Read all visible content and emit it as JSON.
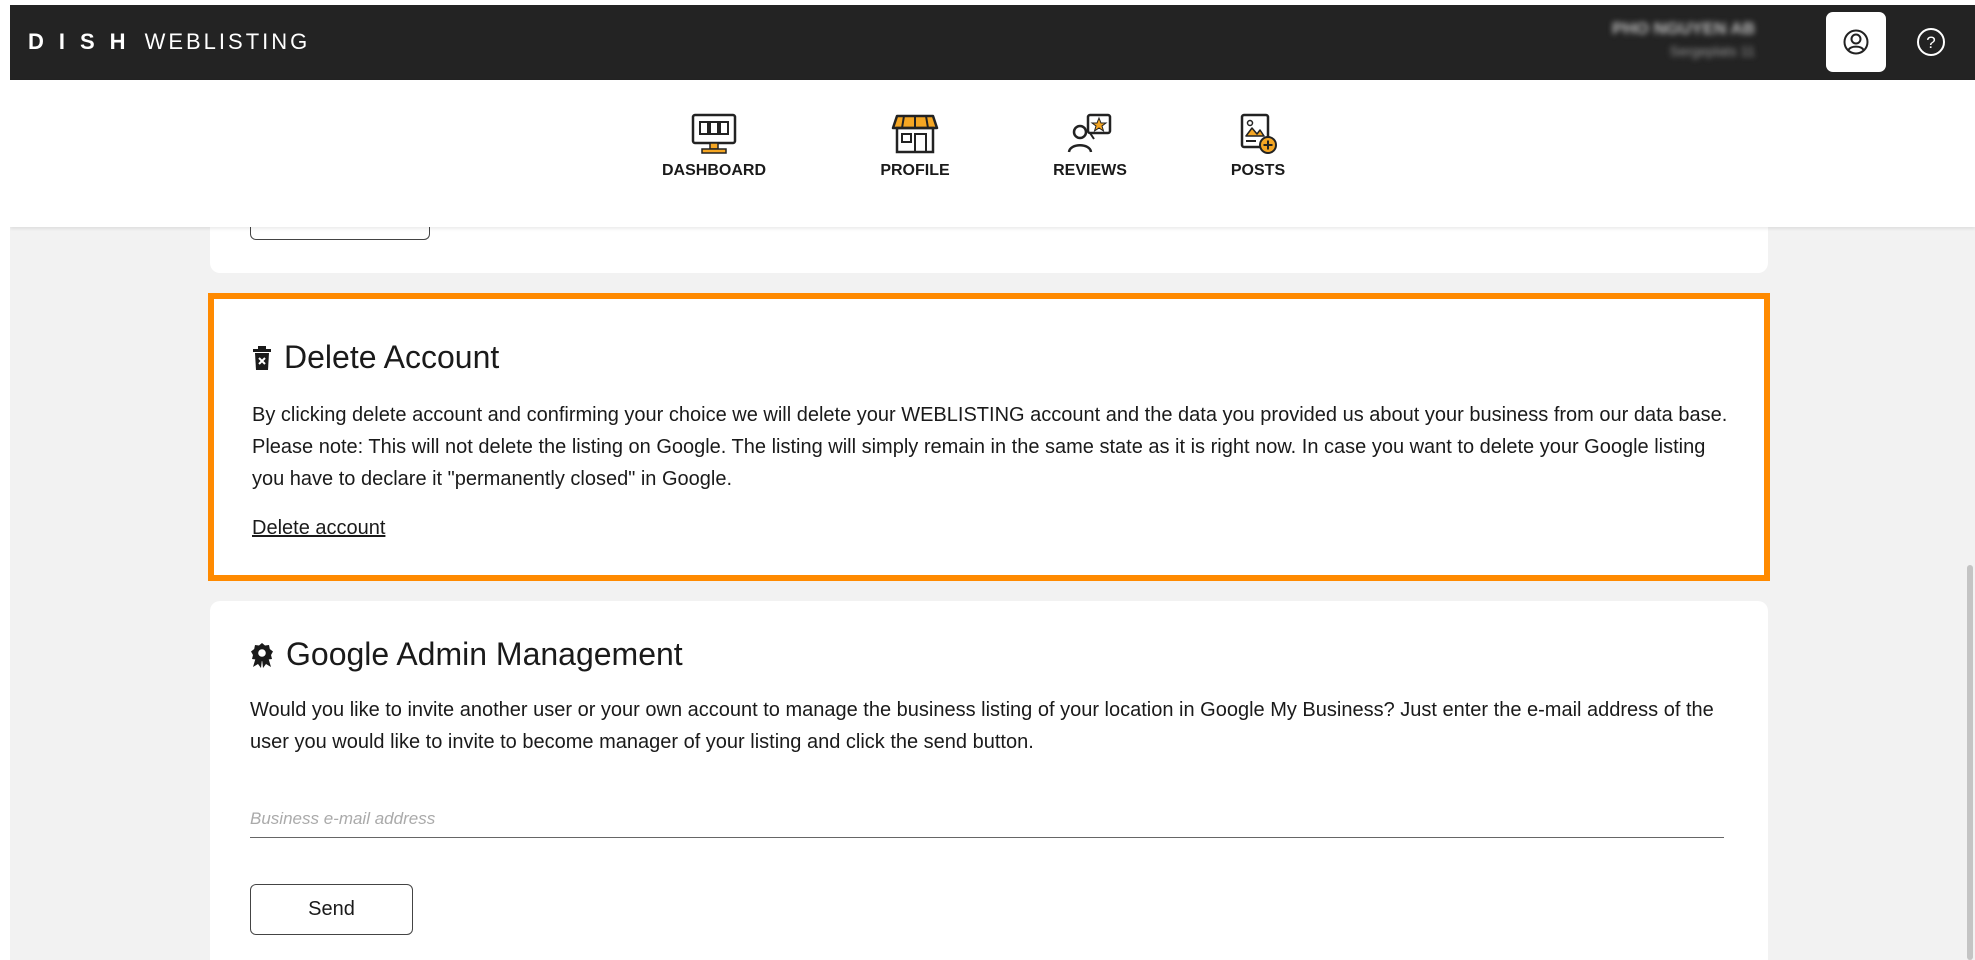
{
  "header": {
    "logo_mark": "DISH",
    "logo_text": "WEBLISTING",
    "user_name": "PHO NGUYEN AB",
    "user_sub": "Sergeplats 11"
  },
  "nav": {
    "items": [
      {
        "label": "DASHBOARD",
        "icon": "dashboard-monitor-icon"
      },
      {
        "label": "PROFILE",
        "icon": "storefront-icon"
      },
      {
        "label": "REVIEWS",
        "icon": "reviews-star-icon"
      },
      {
        "label": "POSTS",
        "icon": "posts-add-image-icon"
      }
    ]
  },
  "delete_account": {
    "title": "Delete Account",
    "icon": "trash-bin-icon",
    "description": "By clicking delete account and confirming your choice we will delete your WEBLISTING account and the data you provided us about your business from our data base. Please note: This will not delete the listing on Google. The listing will simply remain in the same state as it is right now. In case you want to delete your Google listing you have to declare it \"permanently closed\" in Google.",
    "link_label": "Delete account"
  },
  "google_admin": {
    "title": "Google Admin Management",
    "icon": "badge-award-icon",
    "description": "Would you like to invite another user or your own account to manage the business listing of your location in Google My Business? Just enter the e-mail address of the user you would like to invite to become manager of your listing and click the send button.",
    "email_placeholder": "Business e-mail address",
    "send_label": "Send"
  },
  "colors": {
    "highlight": "#ff8a00",
    "accent": "#f5a623",
    "topbar": "#232323"
  }
}
